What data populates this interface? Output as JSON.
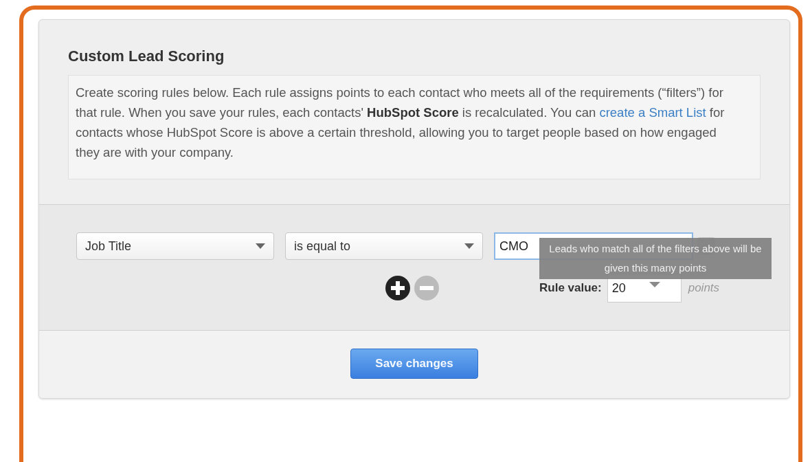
{
  "title": "Custom Lead Scoring",
  "description": {
    "before": "Create scoring rules below. Each rule assigns points to each contact who meets all of the requirements (“filters”) for that rule. When you save your rules, each contacts' **HubSpot Score** is recalculated. You can ",
    "link": "create a Smart List",
    "after": " for contacts whose HubSpot Score is above a certain threshold, allowing you to target people based on how engaged they are with your company."
  },
  "filter": {
    "property": "Job Title",
    "operator": "is equal to",
    "value": "CMO"
  },
  "tooltip": "Leads who match all of the filters above will be given this many points",
  "rule_value": {
    "label": "Rule value:",
    "value": "20",
    "unit": "points"
  },
  "save_button": "Save changes"
}
